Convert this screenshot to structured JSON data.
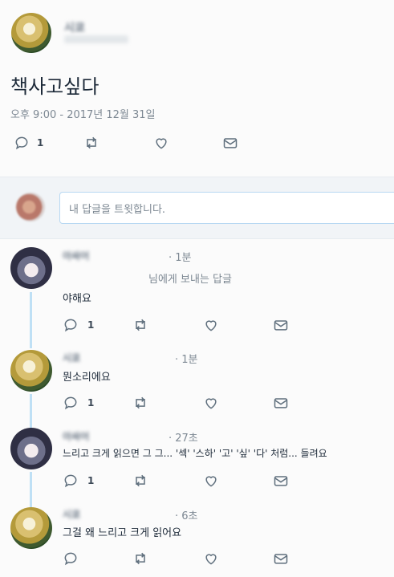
{
  "tweet": {
    "author": "시쿄",
    "text": "책사고싶다",
    "timestamp": "오후 9:00 - 2017년 12월 31일",
    "reply_count": "1"
  },
  "compose": {
    "placeholder": "내 답글을 트윗합니다."
  },
  "replies": [
    {
      "author": "아싸어",
      "time": "· 1분",
      "context": "님에게 보내는 답글",
      "text": "야해요",
      "reply_count": "1"
    },
    {
      "author": "시쿄",
      "time": "· 1분",
      "text": "뭔소리에요",
      "reply_count": "1"
    },
    {
      "author": "아싸어",
      "time": "· 27초",
      "text": "느리고 크게 읽으면 그 그... '섹' '스하' '고' '싶' '다' 처럼... 들려요",
      "reply_count": "1"
    },
    {
      "author": "시쿄",
      "time": "· 6초",
      "text": "그걸 왜 느리고 크게 읽어요",
      "reply_count": ""
    }
  ],
  "colors": {
    "thread_line": "#bfe0f5",
    "icon": "#5f6f7d",
    "accent_border": "#b8d8f2"
  },
  "icons": [
    "reply-icon",
    "retweet-icon",
    "like-icon",
    "dm-icon"
  ]
}
